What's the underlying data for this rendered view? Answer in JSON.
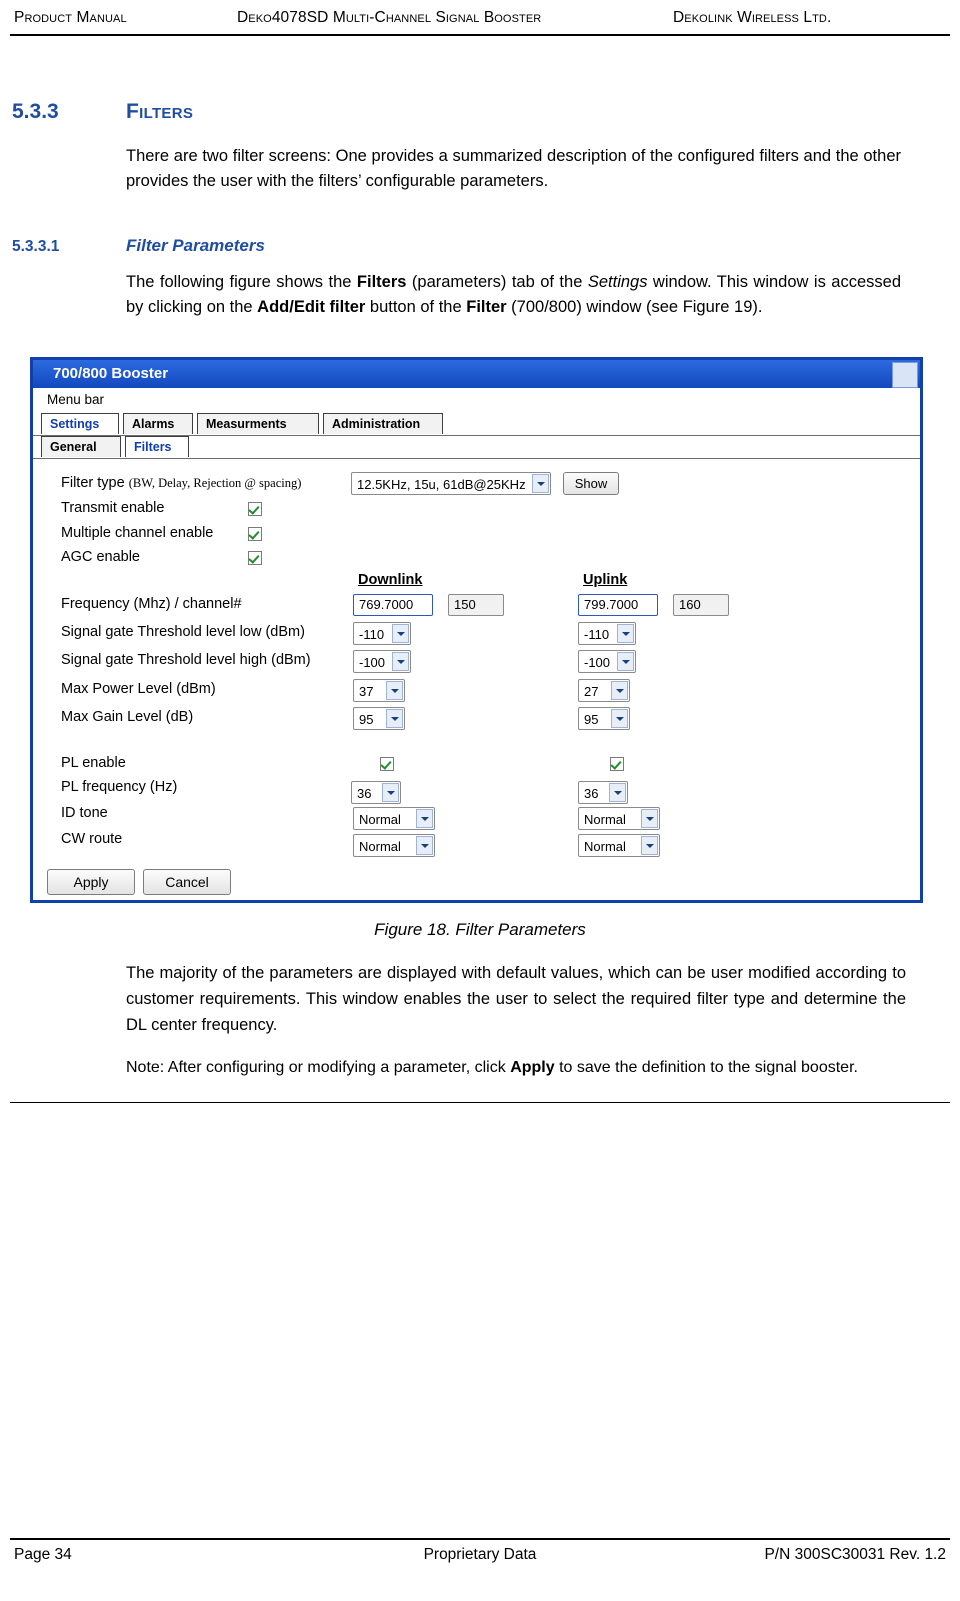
{
  "header": {
    "left": "Product Manual",
    "middle": "Deko4078SD Multi-Channel Signal Booster",
    "right": "Dekolink Wireless Ltd."
  },
  "footer": {
    "page": "Page 34",
    "center": "Proprietary Data",
    "right": "P/N 300SC30031 Rev. 1.2"
  },
  "sections": {
    "s533_num": "5.3.3",
    "s533_title": "Filters",
    "s533_body": "There are two filter screens: One provides a summarized description of the configured filters and the other provides the user with the filters’ configurable parameters.",
    "s5331_num": "5.3.3.1",
    "s5331_title": "Filter Parameters",
    "s5331_body_pre": "The following figure shows the ",
    "s5331_body_b1": "Filters",
    "s5331_body_mid1": " (parameters) tab of the ",
    "s5331_body_i1": "Settings",
    "s5331_body_mid2": " window. This window is accessed by clicking on the ",
    "s5331_body_b2": "Add/Edit filter",
    "s5331_body_mid3": " button of the ",
    "s5331_body_b3": "Filter",
    "s5331_body_end": " (700/800) window (see Figure 19)."
  },
  "figure": {
    "caption": "Figure 18. Filter Parameters"
  },
  "after_figure": {
    "paragraph": "The majority of the parameters are displayed with default values, which can be user modified according to customer requirements. This window enables the user to select the required filter type and determine the DL center frequency.",
    "note_pre": "Note: After configuring or modifying a parameter, click ",
    "note_bold": "Apply",
    "note_post": " to save the definition to the signal booster."
  },
  "screenshot": {
    "window_title": "700/800 Booster",
    "menu_bar_label": "Menu bar",
    "tabs_row1": [
      {
        "label": "Settings",
        "selected": true
      },
      {
        "label": "Alarms",
        "selected": false
      },
      {
        "label": "Measurments",
        "selected": false
      },
      {
        "label": "Administration",
        "selected": false
      }
    ],
    "tabs_row2": [
      {
        "label": "General",
        "selected": false
      },
      {
        "label": "Filters",
        "selected": true
      }
    ],
    "filter_type": {
      "label_main": "Filter type ",
      "label_sub": "(BW, Delay, Rejection @ spacing)",
      "value": "12.5KHz, 15u, 61dB@25KHz",
      "show_button": "Show"
    },
    "checkboxes": [
      {
        "label": "Transmit enable",
        "checked": true
      },
      {
        "label": "Multiple channel enable",
        "checked": true
      },
      {
        "label": "AGC enable",
        "checked": true
      }
    ],
    "column_headers": {
      "downlink": "Downlink",
      "uplink": "Uplink"
    },
    "rows": [
      {
        "label": "Frequency  (Mhz)          / channel#",
        "downlink": "769.7000",
        "downlink_channel": "150",
        "uplink": "799.7000",
        "uplink_channel": "160",
        "type": "text"
      },
      {
        "label": "Signal gate Threshold level low (dBm)",
        "downlink": "-110",
        "uplink": "-110",
        "type": "select"
      },
      {
        "label": "Signal gate Threshold level high (dBm)",
        "downlink": "-100",
        "uplink": "-100",
        "type": "select"
      },
      {
        "label": "Max Power Level (dBm)",
        "downlink": "37",
        "uplink": "27",
        "type": "select"
      },
      {
        "label": "Max Gain Level (dB)",
        "downlink": "95",
        "uplink": "95",
        "type": "select"
      }
    ],
    "pl_rows": [
      {
        "label": "PL enable",
        "type": "checkbox",
        "downlink": true,
        "uplink": true
      },
      {
        "label": "PL frequency (Hz)",
        "type": "select",
        "downlink": "36",
        "uplink": "36"
      },
      {
        "label": "ID tone",
        "type": "select",
        "downlink": "Normal",
        "uplink": "Normal"
      },
      {
        "label": "CW route",
        "type": "select",
        "downlink": "Normal",
        "uplink": "Normal"
      }
    ],
    "buttons": {
      "apply": "Apply",
      "cancel": "Cancel"
    }
  }
}
